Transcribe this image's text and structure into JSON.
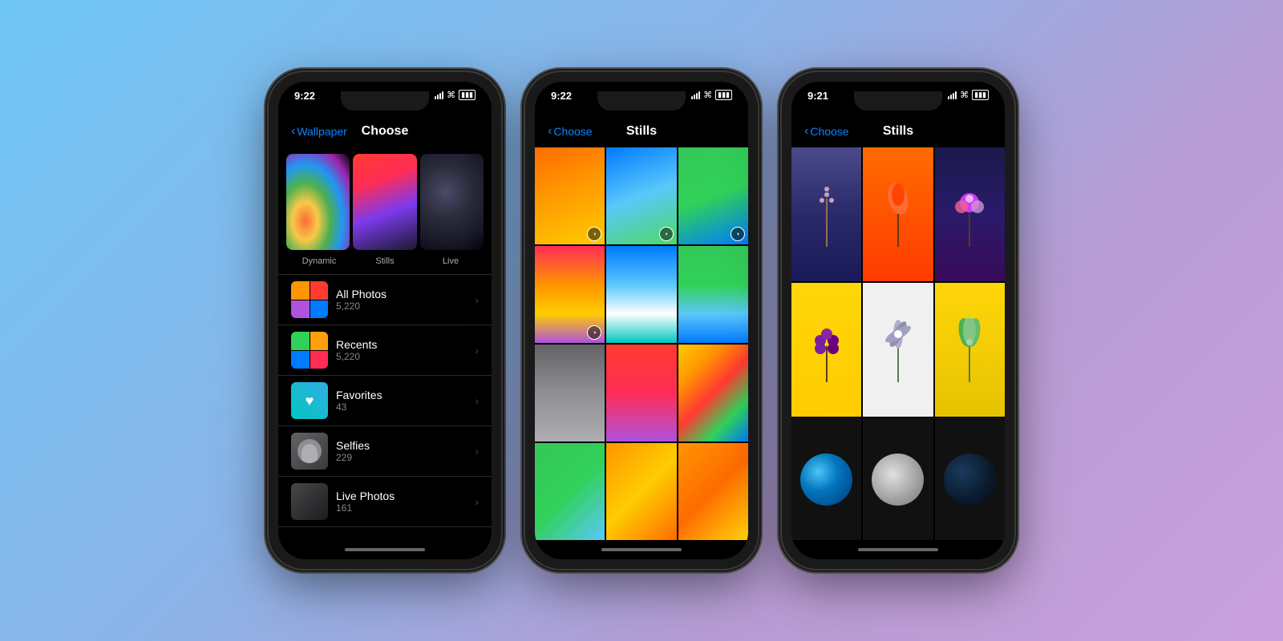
{
  "background": {
    "gradient_start": "#6ec6f5",
    "gradient_end": "#c9a0dc"
  },
  "phones": [
    {
      "id": "phone1",
      "time": "9:22",
      "screen": "choose",
      "nav": {
        "back_label": "Wallpaper",
        "title": "Choose"
      },
      "wallpaper_types": [
        "Dynamic",
        "Stills",
        "Live"
      ],
      "albums": [
        {
          "name": "All Photos",
          "count": "5,220",
          "thumb": "all"
        },
        {
          "name": "Recents",
          "count": "5,220",
          "thumb": "recents"
        },
        {
          "name": "Favorites",
          "count": "43",
          "thumb": "favorites"
        },
        {
          "name": "Selfies",
          "count": "229",
          "thumb": "selfies"
        },
        {
          "name": "Live Photos",
          "count": "161",
          "thumb": "live"
        }
      ]
    },
    {
      "id": "phone2",
      "time": "9:22",
      "screen": "stills",
      "nav": {
        "back_label": "Choose",
        "title": "Stills"
      },
      "grid_cells": 12
    },
    {
      "id": "phone3",
      "time": "9:21",
      "screen": "stills-flowers",
      "nav": {
        "back_label": "Choose",
        "title": "Stills"
      },
      "grid_cells": 9
    }
  ]
}
